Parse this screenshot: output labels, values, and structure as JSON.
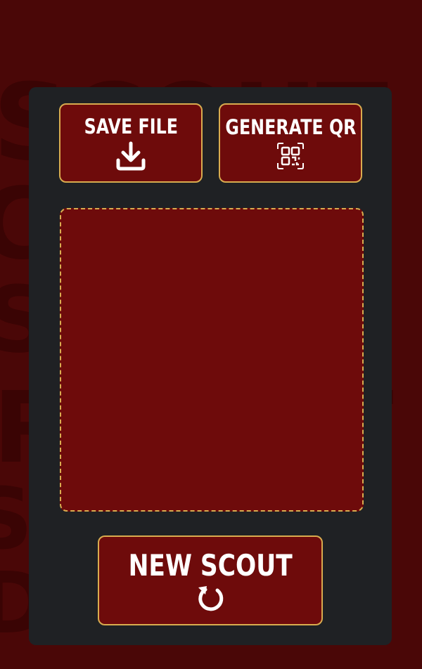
{
  "colors": {
    "page_background": "#4a0707",
    "panel_background": "#1f2124",
    "button_fill": "#6e0b0b",
    "accent_border": "#d9ac4f",
    "text": "#ffffff"
  },
  "toolbar": {
    "save_label": "SAVE FILE",
    "save_icon": "download-icon",
    "qr_label": "GENERATE QR",
    "qr_icon": "qr-code-icon"
  },
  "qr_area": {
    "state": "empty"
  },
  "footer": {
    "new_scout_label": "NEW SCOUT",
    "new_scout_icon": "refresh-icon"
  }
}
